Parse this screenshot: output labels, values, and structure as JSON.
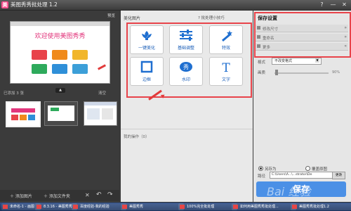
{
  "window": {
    "title": "美图秀秀批处理 1.2",
    "controls": [
      "?",
      "—",
      "✕"
    ]
  },
  "preview": {
    "label": "预览",
    "welcome": "欢迎使用美图秀秀"
  },
  "thumbnails": {
    "count_label": "已添加 3 张",
    "clear_label": "清空",
    "collapse": "▲"
  },
  "bottom_bar": {
    "add_image": "添加图片",
    "add_folder": "添加文件夹",
    "delete": "✕",
    "rotate_left": "↶",
    "rotate_right": "↷"
  },
  "beautify": {
    "title": "美化图片",
    "tips": "批处理小技巧",
    "tools": [
      {
        "label": "一键美化",
        "icon": "flower-icon"
      },
      {
        "label": "基础调整",
        "icon": "sliders-icon"
      },
      {
        "label": "特效",
        "icon": "magic-wand-icon"
      },
      {
        "label": "边框",
        "icon": "frame-icon"
      },
      {
        "label": "水印",
        "icon": "watermark-icon"
      },
      {
        "label": "文字",
        "icon": "text-icon"
      }
    ],
    "history_label": "我的操作（0）"
  },
  "save_settings": {
    "title": "保存设置",
    "rows": [
      {
        "label": "修改尺寸",
        "chevron": "»"
      },
      {
        "label": "重命名",
        "chevron": "»"
      },
      {
        "label": "更多",
        "chevron": "«"
      }
    ],
    "format_label": "格式",
    "format_value": "不改变格式",
    "quality_label": "画质",
    "quality_value": "90%",
    "quality_fraction": 0.02,
    "save_as": "另存为",
    "overwrite": "覆盖原图",
    "path_label": "路径",
    "path_value": "C:\\Users\\A...\\...strator\\De",
    "browse": "更改",
    "save_button": "保存",
    "watermark_text": "Bai 经验"
  },
  "taskbar": {
    "items": [
      "未命名-1 - 画图",
      "8.3.16 - 美图秀秀",
      "百度经验-我的经验",
      "美图秀秀",
      "100%完全批处理",
      "如何用美图秀秀批处理...",
      "美图秀秀批处理1.2"
    ]
  },
  "colors": {
    "highlight": "#e8434a",
    "save_button": "#4b90e6",
    "tool_label": "#1a5eb8",
    "brand_pink": "#e2367c"
  }
}
